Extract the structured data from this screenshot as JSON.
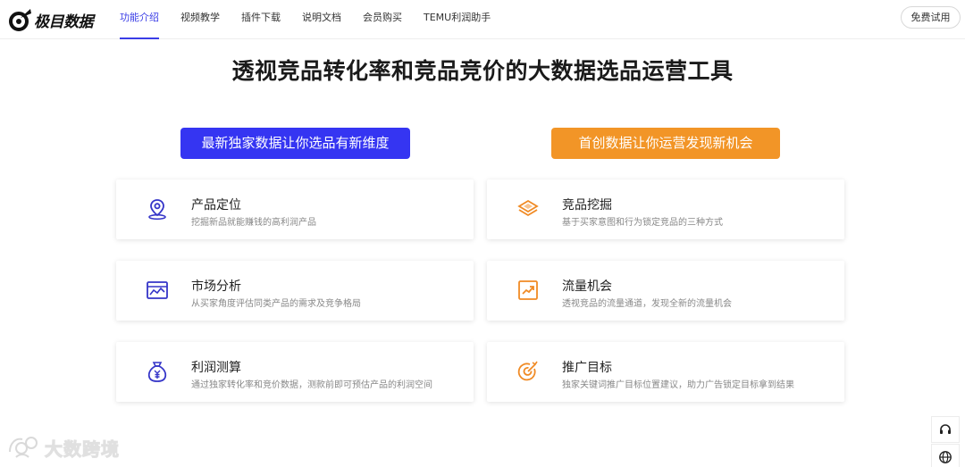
{
  "header": {
    "logo_text": "极目数据",
    "nav": [
      {
        "label": "功能介绍",
        "active": true
      },
      {
        "label": "视频教学"
      },
      {
        "label": "插件下载"
      },
      {
        "label": "说明文档"
      },
      {
        "label": "会员购买"
      },
      {
        "label": "TEMU利润助手"
      }
    ],
    "trial_label": "免费试用"
  },
  "main": {
    "headline": "透视竞品转化率和竞品竞价的大数据选品运营工具",
    "left_banner": "最新独家数据让你选品有新维度",
    "right_banner": "首创数据让你运营发现新机会",
    "colors": {
      "blue": "#3535f2",
      "orange": "#f29527"
    },
    "features": [
      {
        "icon": "location-pin-icon",
        "title": "产品定位",
        "desc": "挖掘新品就能赚钱的高利润产品"
      },
      {
        "icon": "layers-icon",
        "title": "竞品挖掘",
        "desc": "基于买家意图和行为锁定竞品的三种方式"
      },
      {
        "icon": "chart-window-icon",
        "title": "市场分析",
        "desc": "从买家角度评估同类产品的需求及竞争格局"
      },
      {
        "icon": "trend-up-icon",
        "title": "流量机会",
        "desc": "透视竞品的流量通道，发现全新的流量机会"
      },
      {
        "icon": "money-bag-icon",
        "title": "利润测算",
        "desc": "通过独家转化率和竞价数据，测款前即可预估产品的利润空间"
      },
      {
        "icon": "target-icon",
        "title": "推广目标",
        "desc": "独家关键词推广目标位置建议，助力广告锁定目标拿到结果"
      }
    ]
  },
  "watermark": {
    "text": "大数跨境"
  },
  "floating": [
    {
      "icon": "headset-icon"
    },
    {
      "icon": "globe-icon"
    }
  ]
}
